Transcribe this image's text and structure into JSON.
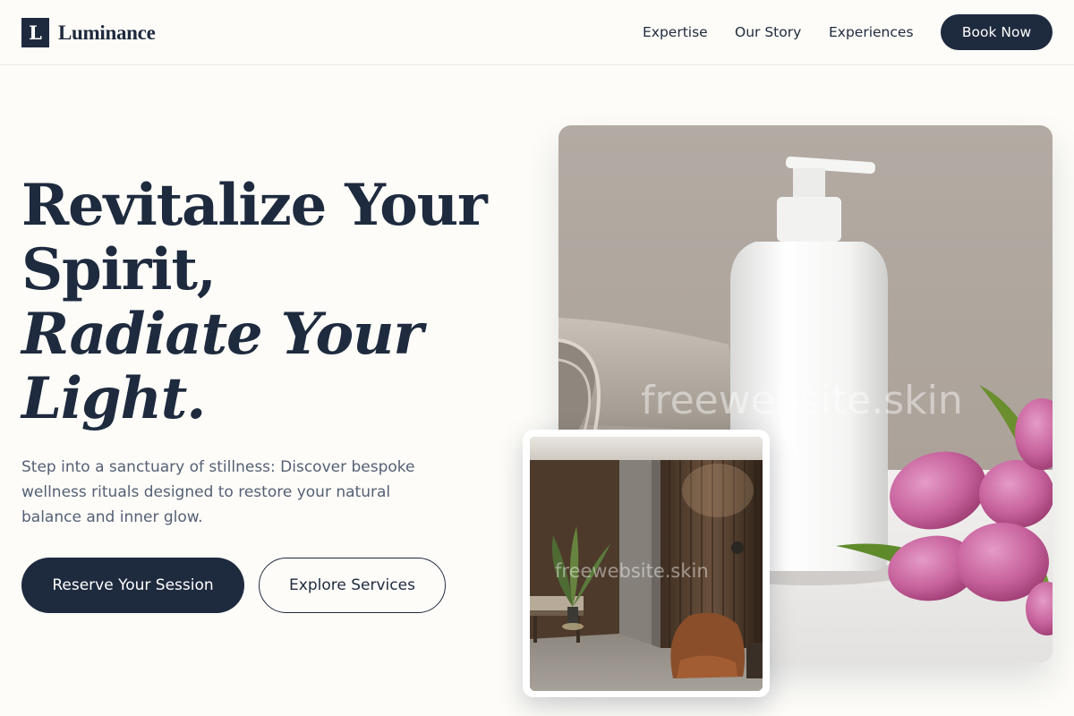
{
  "brand": {
    "mark": "L",
    "name": "Luminance"
  },
  "nav": {
    "links": [
      "Expertise",
      "Our Story",
      "Experiences"
    ],
    "cta": "Book Now"
  },
  "hero": {
    "title_line1": "Revitalize Your",
    "title_line2": "Spirit,",
    "title_line3": "Radiate Your",
    "title_line4": "Light.",
    "description": "Step into a sanctuary of stillness: Discover bespoke wellness rituals designed to restore your natural balance and inner glow.",
    "primary_cta": "Reserve Your Session",
    "secondary_cta": "Explore Services"
  },
  "images": {
    "main_watermark": "freewebsite.skin",
    "inset_watermark": "freewebsite.skin"
  },
  "colors": {
    "primary": "#1e2a3e",
    "background": "#fdfcf8",
    "body_text": "#556075"
  }
}
